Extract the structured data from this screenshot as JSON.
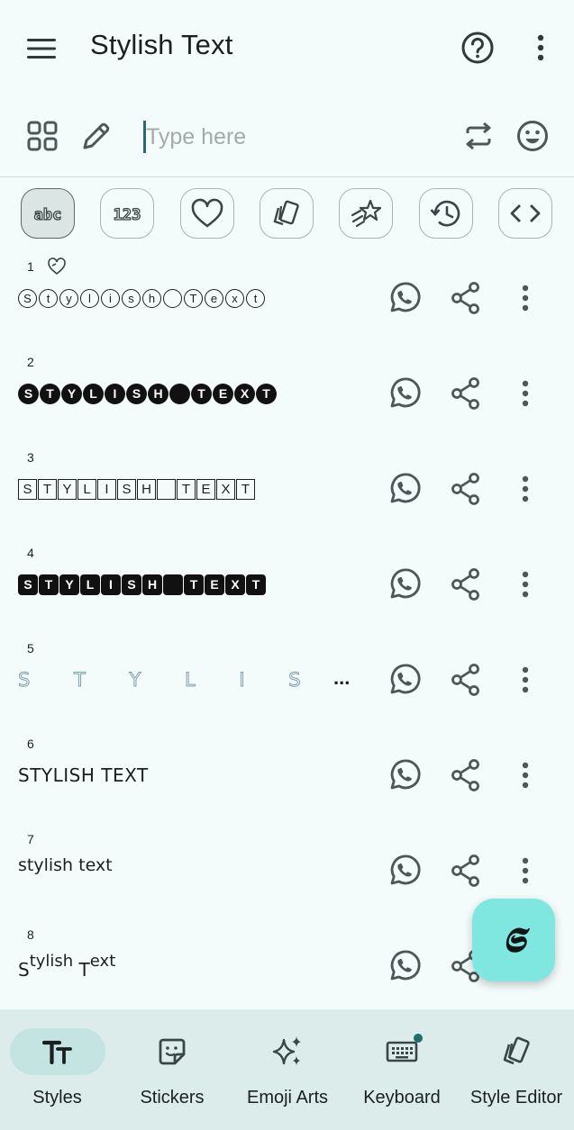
{
  "app_bar": {
    "title": "Stylish Text"
  },
  "input_bar": {
    "placeholder": "Type here",
    "value": ""
  },
  "categories": [
    "abc",
    "123",
    "favorites",
    "themes",
    "effects",
    "history",
    "code"
  ],
  "styles": [
    {
      "number": "1",
      "text": "Ⓢⓣⓨⓛⓘⓢⓗ Ⓣⓔⓧⓣ",
      "style": "circle-outline",
      "favorite": true
    },
    {
      "number": "2",
      "text": "🅢🅣🅨🅛🅘🅢🅗 🅣🅔🅧🅣",
      "style": "circle-filled"
    },
    {
      "number": "3",
      "text": "🅂🅃🅈🄻🄸🅂🄷 🅃🄴🅇🅃",
      "style": "square-outline"
    },
    {
      "number": "4",
      "text": "🆂🆃🆈🅻🅸🆂🅷 🆃🅴🆇🆃",
      "style": "square-filled"
    },
    {
      "number": "5",
      "text": "S T Y L I S H T E",
      "style": "outline-spaced",
      "truncated": "..."
    },
    {
      "number": "6",
      "text": "STYLISH TEXT",
      "style": "caps"
    },
    {
      "number": "7",
      "text": "stylish text",
      "style": "small"
    },
    {
      "number": "8",
      "text": "Stylish Text",
      "style": "superscript",
      "parts": [
        "S",
        "tylish",
        " T",
        "ext"
      ]
    }
  ],
  "fab": {
    "glyph": "𝕾"
  },
  "bottom_nav": [
    {
      "label": "Styles",
      "icon": "text-format-icon",
      "active": true
    },
    {
      "label": "Stickers",
      "icon": "sticker-icon"
    },
    {
      "label": "Emoji Arts",
      "icon": "sparkles-icon"
    },
    {
      "label": "Keyboard",
      "icon": "keyboard-icon",
      "badge": true
    },
    {
      "label": "Style Editor",
      "icon": "style-editor-icon"
    }
  ],
  "colors": {
    "background": "#f4fcfb",
    "icon": "#4b5857",
    "accent": "#7fe7e0",
    "nav": "#dceceb"
  }
}
